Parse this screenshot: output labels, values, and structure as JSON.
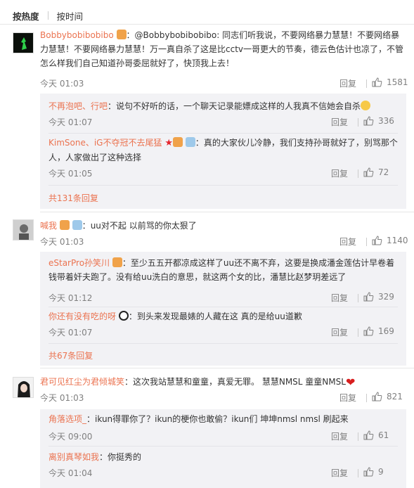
{
  "sort": {
    "hot": "按热度",
    "time": "按时间"
  },
  "comments": [
    {
      "user": "Bobbybobibobibo",
      "text": "@Bobbybobibobibo: 同志们听我说，不要网络暴力慧慧！不要网络暴力慧慧！不要网络暴力慧慧！万一真自杀了这是比cctv一哥更大的节奏，德云色估计也凉了，不管怎么样我们自己知道孙哥委屈就好了，快顶我上去！",
      "time": "今天 01:03",
      "reply": "回复",
      "likes": "1581",
      "subs": [
        {
          "user": "不再泡吧、行吧",
          "text": "说句不好听的话，一个聊天记录能嫖成这样的人我真不信她会自杀",
          "time": "今天 01:07",
          "reply": "回复",
          "likes": "336"
        },
        {
          "user": "KimSone、iG不夺冠不去尾猛",
          "text": "真的大家伙儿冷静，我们支持孙哥就好了，别骂那个人，人家做出了这种选择",
          "time": "今天 01:05",
          "reply": "回复",
          "likes": "72"
        }
      ],
      "more": "共131条回复"
    },
    {
      "user": "喊我",
      "text": "uu对不起 以前骂的你太狠了",
      "time": "今天 01:03",
      "reply": "回复",
      "likes": "1140",
      "subs": [
        {
          "user": "eStarPro孙笑川",
          "text": "至少五五开都凉成这样了uu还不离不弃，这要是换成潘金莲估计早卷着钱带着奸夫跑了。没有给uu洗白的意思，就这两个女的比，潘慧比赵梦玥差远了",
          "time": "今天 01:12",
          "reply": "回复",
          "likes": "329"
        },
        {
          "user": "你还有没有吃的呀",
          "text": "到头来发现最婊的人藏在这 真的是给uu道歉",
          "time": "今天 01:07",
          "reply": "回复",
          "likes": "169"
        }
      ],
      "more": "共67条回复"
    },
    {
      "user": "君可见红尘为君倾城笑",
      "text": "这次我站慧慧和童童，真爱无罪。 慧慧NMSL  童童NMSL",
      "time": "今天 01:03",
      "reply": "回复",
      "likes": "821",
      "subs": [
        {
          "user": "角落选项_",
          "text": "ikun得罪你了？ikun的梗你也敢偷？ikun们 坤坤nmsl  nmsl  刷起来",
          "time": "今天 09:00",
          "reply": "回复",
          "likes": "61"
        },
        {
          "user": "离别真琴如我",
          "text": "你挺秀的",
          "time": "今天 01:04",
          "reply": "回复",
          "likes": "9"
        }
      ]
    }
  ]
}
